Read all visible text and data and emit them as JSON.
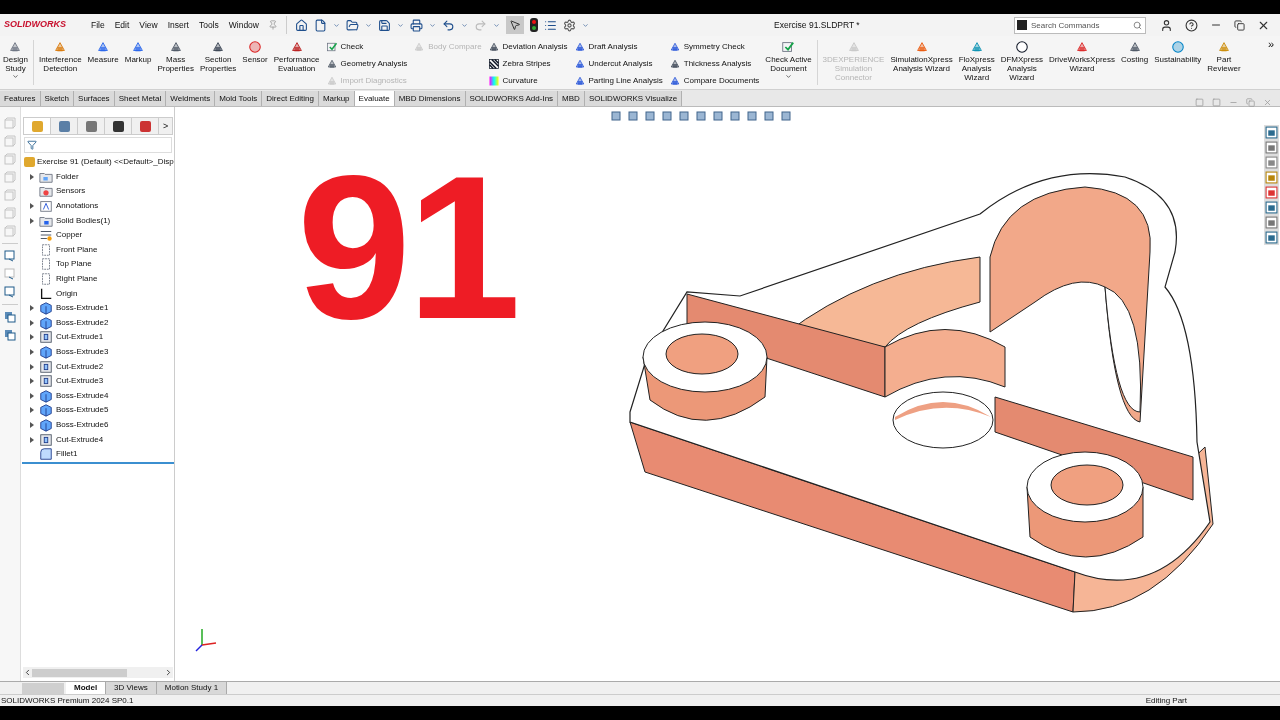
{
  "app": {
    "logo": "SOLIDWORKS",
    "menu": [
      "File",
      "Edit",
      "View",
      "Insert",
      "Tools",
      "Window"
    ],
    "document_title": "Exercise 91.SLDPRT *",
    "search": {
      "placeholder": "Search Commands"
    }
  },
  "ribbon": [
    {
      "kind": "large",
      "label": "Design\nStudy",
      "disabled": false,
      "has_menu": true
    },
    {
      "kind": "separator"
    },
    {
      "kind": "large",
      "label": "Interference\nDetection",
      "disabled": false,
      "has_menu": false
    },
    {
      "kind": "large",
      "label": "Measure",
      "disabled": false,
      "has_menu": false
    },
    {
      "kind": "large",
      "label": "Markup",
      "disabled": false,
      "has_menu": false
    },
    {
      "kind": "large",
      "label": "Mass\nProperties",
      "disabled": false,
      "has_menu": false
    },
    {
      "kind": "large",
      "label": "Section\nProperties",
      "disabled": false,
      "has_menu": false
    },
    {
      "kind": "large",
      "label": "Sensor",
      "disabled": false,
      "has_menu": false
    },
    {
      "kind": "large",
      "label": "Performance\nEvaluation",
      "disabled": false,
      "has_menu": false
    },
    {
      "kind": "column",
      "items": [
        {
          "label": "Check",
          "disabled": false
        },
        {
          "label": "Geometry Analysis",
          "disabled": false
        },
        {
          "label": "Import Diagnostics",
          "disabled": true
        }
      ]
    },
    {
      "kind": "column",
      "items": [
        {
          "label": "Body Compare",
          "disabled": true
        }
      ]
    },
    {
      "kind": "column",
      "items": [
        {
          "label": "Deviation Analysis",
          "disabled": false
        },
        {
          "label": "Zebra Stripes",
          "disabled": false
        },
        {
          "label": "Curvature",
          "disabled": false
        }
      ]
    },
    {
      "kind": "column",
      "items": [
        {
          "label": "Draft Analysis",
          "disabled": false
        },
        {
          "label": "Undercut Analysis",
          "disabled": false
        },
        {
          "label": "Parting Line Analysis",
          "disabled": false
        }
      ]
    },
    {
      "kind": "column",
      "items": [
        {
          "label": "Symmetry Check",
          "disabled": false
        },
        {
          "label": "Thickness Analysis",
          "disabled": false
        },
        {
          "label": "Compare Documents",
          "disabled": false
        }
      ]
    },
    {
      "kind": "large",
      "label": "Check Active\nDocument",
      "disabled": false,
      "has_menu": true
    },
    {
      "kind": "separator"
    },
    {
      "kind": "large",
      "label": "3DEXPERIENCE\nSimulation\nConnector",
      "disabled": true,
      "has_menu": false
    },
    {
      "kind": "large",
      "label": "SimulationXpress\nAnalysis Wizard",
      "disabled": false,
      "has_menu": false
    },
    {
      "kind": "large",
      "label": "FloXpress\nAnalysis\nWizard",
      "disabled": false,
      "has_menu": false
    },
    {
      "kind": "large",
      "label": "DFMXpress\nAnalysis\nWizard",
      "disabled": false,
      "has_menu": false
    },
    {
      "kind": "large",
      "label": "DriveWorksXpress\nWizard",
      "disabled": false,
      "has_menu": false
    },
    {
      "kind": "large",
      "label": "Costing",
      "disabled": false,
      "has_menu": false
    },
    {
      "kind": "large",
      "label": "Sustainability",
      "disabled": false,
      "has_menu": false
    },
    {
      "kind": "large",
      "label": "Part\nReviewer",
      "disabled": false,
      "has_menu": false
    }
  ],
  "ribbon_more": "»",
  "command_tabs": [
    {
      "label": "Features",
      "selected": false
    },
    {
      "label": "Sketch",
      "selected": false
    },
    {
      "label": "Surfaces",
      "selected": false
    },
    {
      "label": "Sheet Metal",
      "selected": false
    },
    {
      "label": "Weldments",
      "selected": false
    },
    {
      "label": "Mold Tools",
      "selected": false
    },
    {
      "label": "Direct Editing",
      "selected": false
    },
    {
      "label": "Markup",
      "selected": false
    },
    {
      "label": "Evaluate",
      "selected": true
    },
    {
      "label": "MBD Dimensions",
      "selected": false
    },
    {
      "label": "SOLIDWORKS Add-Ins",
      "selected": false
    },
    {
      "label": "MBD",
      "selected": false
    },
    {
      "label": "SOLIDWORKS Visualize",
      "selected": false
    }
  ],
  "feature_tree": {
    "root": "Exercise 91 (Default) <<Default>_Disp",
    "more_tabs": ">",
    "items": [
      {
        "label": "Folder",
        "kind": "folder",
        "expandable": true
      },
      {
        "label": "Sensors",
        "kind": "sensors",
        "expandable": false
      },
      {
        "label": "Annotations",
        "kind": "annotations",
        "expandable": true
      },
      {
        "label": "Solid Bodies(1)",
        "kind": "bodies",
        "expandable": true
      },
      {
        "label": "Copper",
        "kind": "material",
        "expandable": false
      },
      {
        "label": "Front Plane",
        "kind": "plane",
        "expandable": false
      },
      {
        "label": "Top Plane",
        "kind": "plane",
        "expandable": false
      },
      {
        "label": "Right Plane",
        "kind": "plane",
        "expandable": false
      },
      {
        "label": "Origin",
        "kind": "origin",
        "expandable": false
      },
      {
        "label": "Boss-Extrude1",
        "kind": "boss",
        "expandable": true
      },
      {
        "label": "Boss-Extrude2",
        "kind": "boss",
        "expandable": true
      },
      {
        "label": "Cut-Extrude1",
        "kind": "cut",
        "expandable": true
      },
      {
        "label": "Boss-Extrude3",
        "kind": "boss",
        "expandable": true
      },
      {
        "label": "Cut-Extrude2",
        "kind": "cut",
        "expandable": true
      },
      {
        "label": "Cut-Extrude3",
        "kind": "cut",
        "expandable": true
      },
      {
        "label": "Boss-Extrude4",
        "kind": "boss",
        "expandable": true
      },
      {
        "label": "Boss-Extrude5",
        "kind": "boss",
        "expandable": true
      },
      {
        "label": "Boss-Extrude6",
        "kind": "boss",
        "expandable": true
      },
      {
        "label": "Cut-Extrude4",
        "kind": "cut",
        "expandable": true
      },
      {
        "label": "Fillet1",
        "kind": "fillet",
        "expandable": false
      }
    ]
  },
  "viewport": {
    "overlay_number": "91"
  },
  "bottom_tabs": [
    {
      "label": "Model",
      "selected": true
    },
    {
      "label": "3D Views",
      "selected": false
    },
    {
      "label": "Motion Study 1",
      "selected": false
    }
  ],
  "status_bar": {
    "version": "SOLIDWORKS Premium 2024 SP0.1",
    "mode": "Editing Part"
  }
}
